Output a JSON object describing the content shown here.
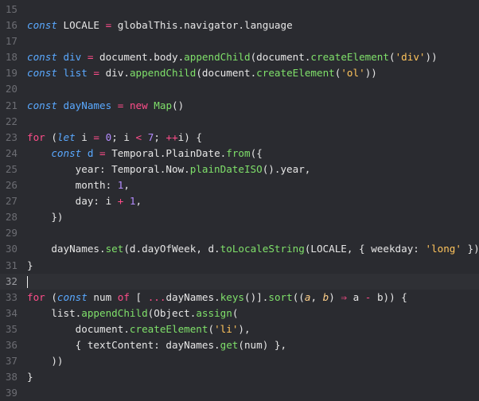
{
  "editor": {
    "current_line": 32,
    "colors": {
      "background": "#2a2b30",
      "line_number": "#6c6d73",
      "keyword_italic": "#5aa9ff",
      "keyword": "#ff4d8a",
      "function": "#7fe06a",
      "string": "#ffc45c",
      "number": "#b48cff",
      "parameter": "#ffd08a",
      "text": "#e6e6e6"
    },
    "lines": [
      {
        "n": "15",
        "tokens": []
      },
      {
        "n": "16",
        "tokens": [
          {
            "t": "const",
            "c": "kw-i"
          },
          {
            "t": " LOCALE ",
            "c": "plain"
          },
          {
            "t": "=",
            "c": "op"
          },
          {
            "t": " globalThis.navigator.language",
            "c": "plain"
          }
        ]
      },
      {
        "n": "17",
        "tokens": []
      },
      {
        "n": "18",
        "tokens": [
          {
            "t": "const",
            "c": "kw-i"
          },
          {
            "t": " div ",
            "c": "var"
          },
          {
            "t": "=",
            "c": "op"
          },
          {
            "t": " document.body.",
            "c": "plain"
          },
          {
            "t": "appendChild",
            "c": "fn"
          },
          {
            "t": "(document.",
            "c": "plain"
          },
          {
            "t": "createElement",
            "c": "fn"
          },
          {
            "t": "(",
            "c": "plain"
          },
          {
            "t": "'div'",
            "c": "str"
          },
          {
            "t": "))",
            "c": "plain"
          }
        ]
      },
      {
        "n": "19",
        "tokens": [
          {
            "t": "const",
            "c": "kw-i"
          },
          {
            "t": " list ",
            "c": "var"
          },
          {
            "t": "=",
            "c": "op"
          },
          {
            "t": " div.",
            "c": "plain"
          },
          {
            "t": "appendChild",
            "c": "fn"
          },
          {
            "t": "(document.",
            "c": "plain"
          },
          {
            "t": "createElement",
            "c": "fn"
          },
          {
            "t": "(",
            "c": "plain"
          },
          {
            "t": "'ol'",
            "c": "str"
          },
          {
            "t": "))",
            "c": "plain"
          }
        ]
      },
      {
        "n": "20",
        "tokens": []
      },
      {
        "n": "21",
        "tokens": [
          {
            "t": "const",
            "c": "kw-i"
          },
          {
            "t": " dayNames ",
            "c": "var"
          },
          {
            "t": "=",
            "c": "op"
          },
          {
            "t": " ",
            "c": "plain"
          },
          {
            "t": "new",
            "c": "kw"
          },
          {
            "t": " ",
            "c": "plain"
          },
          {
            "t": "Map",
            "c": "fn"
          },
          {
            "t": "()",
            "c": "plain"
          }
        ]
      },
      {
        "n": "22",
        "tokens": []
      },
      {
        "n": "23",
        "tokens": [
          {
            "t": "for",
            "c": "kw"
          },
          {
            "t": " (",
            "c": "plain"
          },
          {
            "t": "let",
            "c": "kw-i"
          },
          {
            "t": " i ",
            "c": "plain"
          },
          {
            "t": "=",
            "c": "op"
          },
          {
            "t": " ",
            "c": "plain"
          },
          {
            "t": "0",
            "c": "num"
          },
          {
            "t": "; i ",
            "c": "plain"
          },
          {
            "t": "<",
            "c": "op"
          },
          {
            "t": " ",
            "c": "plain"
          },
          {
            "t": "7",
            "c": "num"
          },
          {
            "t": "; ",
            "c": "plain"
          },
          {
            "t": "++",
            "c": "op"
          },
          {
            "t": "i) {",
            "c": "plain"
          }
        ]
      },
      {
        "n": "24",
        "tokens": [
          {
            "t": "    ",
            "c": "plain"
          },
          {
            "t": "const",
            "c": "kw-i"
          },
          {
            "t": " d ",
            "c": "var"
          },
          {
            "t": "=",
            "c": "op"
          },
          {
            "t": " Temporal.PlainDate.",
            "c": "plain"
          },
          {
            "t": "from",
            "c": "fn"
          },
          {
            "t": "({",
            "c": "plain"
          }
        ]
      },
      {
        "n": "25",
        "tokens": [
          {
            "t": "        year: Temporal.Now.",
            "c": "plain"
          },
          {
            "t": "plainDateISO",
            "c": "fn"
          },
          {
            "t": "().year,",
            "c": "plain"
          }
        ]
      },
      {
        "n": "26",
        "tokens": [
          {
            "t": "        month: ",
            "c": "plain"
          },
          {
            "t": "1",
            "c": "num"
          },
          {
            "t": ",",
            "c": "plain"
          }
        ]
      },
      {
        "n": "27",
        "tokens": [
          {
            "t": "        day: i ",
            "c": "plain"
          },
          {
            "t": "+",
            "c": "op"
          },
          {
            "t": " ",
            "c": "plain"
          },
          {
            "t": "1",
            "c": "num"
          },
          {
            "t": ",",
            "c": "plain"
          }
        ]
      },
      {
        "n": "28",
        "tokens": [
          {
            "t": "    })",
            "c": "plain"
          }
        ]
      },
      {
        "n": "29",
        "tokens": []
      },
      {
        "n": "30",
        "tokens": [
          {
            "t": "    dayNames.",
            "c": "plain"
          },
          {
            "t": "set",
            "c": "fn"
          },
          {
            "t": "(d.dayOfWeek, d.",
            "c": "plain"
          },
          {
            "t": "toLocaleString",
            "c": "fn"
          },
          {
            "t": "(LOCALE, { weekday: ",
            "c": "plain"
          },
          {
            "t": "'long'",
            "c": "str"
          },
          {
            "t": " }))",
            "c": "plain"
          }
        ]
      },
      {
        "n": "31",
        "tokens": [
          {
            "t": "}",
            "c": "plain"
          }
        ]
      },
      {
        "n": "32",
        "tokens": []
      },
      {
        "n": "33",
        "tokens": [
          {
            "t": "for",
            "c": "kw"
          },
          {
            "t": " (",
            "c": "plain"
          },
          {
            "t": "const",
            "c": "kw-i"
          },
          {
            "t": " num ",
            "c": "plain"
          },
          {
            "t": "of",
            "c": "kw"
          },
          {
            "t": " [ ",
            "c": "plain"
          },
          {
            "t": "...",
            "c": "op"
          },
          {
            "t": "dayNames.",
            "c": "plain"
          },
          {
            "t": "keys",
            "c": "fn"
          },
          {
            "t": "()].",
            "c": "plain"
          },
          {
            "t": "sort",
            "c": "fn"
          },
          {
            "t": "((",
            "c": "plain"
          },
          {
            "t": "a",
            "c": "par"
          },
          {
            "t": ", ",
            "c": "plain"
          },
          {
            "t": "b",
            "c": "par"
          },
          {
            "t": ") ",
            "c": "plain"
          },
          {
            "t": "⇒",
            "c": "op"
          },
          {
            "t": " a ",
            "c": "plain"
          },
          {
            "t": "-",
            "c": "op"
          },
          {
            "t": " b)) {",
            "c": "plain"
          }
        ]
      },
      {
        "n": "34",
        "tokens": [
          {
            "t": "    list.",
            "c": "plain"
          },
          {
            "t": "appendChild",
            "c": "fn"
          },
          {
            "t": "(Object.",
            "c": "plain"
          },
          {
            "t": "assign",
            "c": "fn"
          },
          {
            "t": "(",
            "c": "plain"
          }
        ]
      },
      {
        "n": "35",
        "tokens": [
          {
            "t": "        document.",
            "c": "plain"
          },
          {
            "t": "createElement",
            "c": "fn"
          },
          {
            "t": "(",
            "c": "plain"
          },
          {
            "t": "'li'",
            "c": "str"
          },
          {
            "t": "),",
            "c": "plain"
          }
        ]
      },
      {
        "n": "36",
        "tokens": [
          {
            "t": "        { textContent: dayNames.",
            "c": "plain"
          },
          {
            "t": "get",
            "c": "fn"
          },
          {
            "t": "(num) },",
            "c": "plain"
          }
        ]
      },
      {
        "n": "37",
        "tokens": [
          {
            "t": "    ))",
            "c": "plain"
          }
        ]
      },
      {
        "n": "38",
        "tokens": [
          {
            "t": "}",
            "c": "plain"
          }
        ]
      },
      {
        "n": "39",
        "tokens": []
      }
    ]
  }
}
